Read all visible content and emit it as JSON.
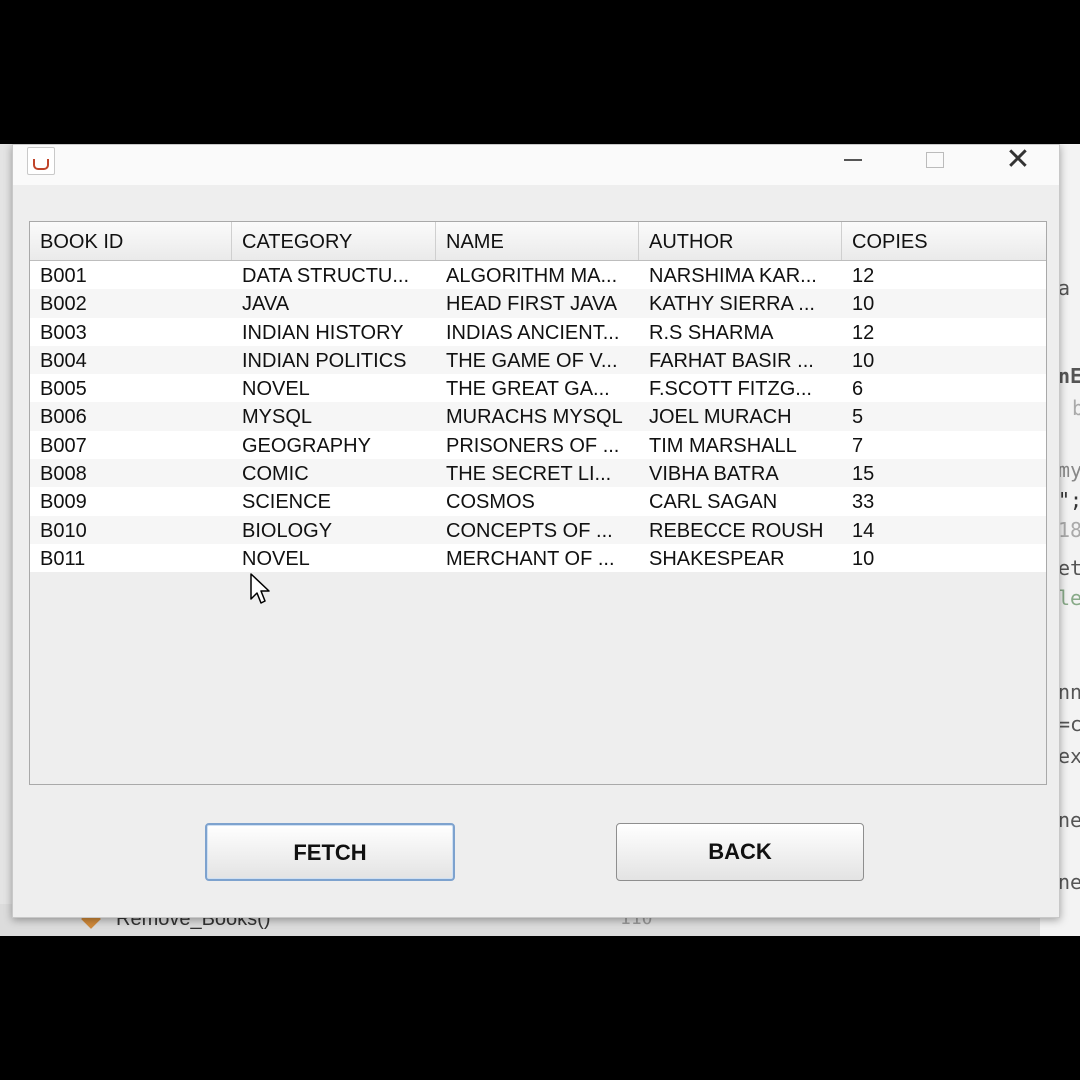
{
  "ide": {
    "right_snippets": [
      "a",
      "nE",
      "b",
      "my",
      "\";",
      "18",
      "et",
      "le",
      "nn",
      "=c",
      "ex",
      "ne",
      "ne"
    ],
    "method_label": "Remove_Books()",
    "line_number": "110"
  },
  "window": {
    "controls": {
      "minimize": "—",
      "close": "✕"
    }
  },
  "table": {
    "columns": [
      "BOOK ID",
      "CATEGORY",
      "NAME",
      "AUTHOR",
      "COPIES"
    ],
    "rows": [
      [
        "B001",
        "DATA STRUCTU...",
        "ALGORITHM MA...",
        "NARSHIMA KAR...",
        "12"
      ],
      [
        "B002",
        "JAVA",
        "HEAD FIRST JAVA",
        "KATHY SIERRA ...",
        "10"
      ],
      [
        "B003",
        "INDIAN HISTORY",
        "INDIAS ANCIENT...",
        "R.S SHARMA",
        "12"
      ],
      [
        "B004",
        "INDIAN POLITICS",
        "THE GAME OF V...",
        "FARHAT BASIR ...",
        "10"
      ],
      [
        "B005",
        "NOVEL",
        "THE GREAT GA...",
        "F.SCOTT FITZG...",
        "6"
      ],
      [
        "B006",
        "MYSQL",
        "MURACHS MYSQL",
        "JOEL MURACH",
        "5"
      ],
      [
        "B007",
        "GEOGRAPHY",
        "PRISONERS OF ...",
        "TIM MARSHALL",
        "7"
      ],
      [
        "B008",
        "COMIC",
        "THE SECRET LI...",
        "VIBHA BATRA",
        "15"
      ],
      [
        "B009",
        "SCIENCE",
        "COSMOS",
        "CARL SAGAN",
        "33"
      ],
      [
        "B010",
        "BIOLOGY",
        "CONCEPTS OF ...",
        "REBECCE ROUSH",
        "14"
      ],
      [
        "B011",
        "NOVEL",
        "MERCHANT OF ...",
        "SHAKESPEAR",
        "10"
      ]
    ]
  },
  "buttons": {
    "fetch_label": "FETCH",
    "back_label": "BACK"
  }
}
